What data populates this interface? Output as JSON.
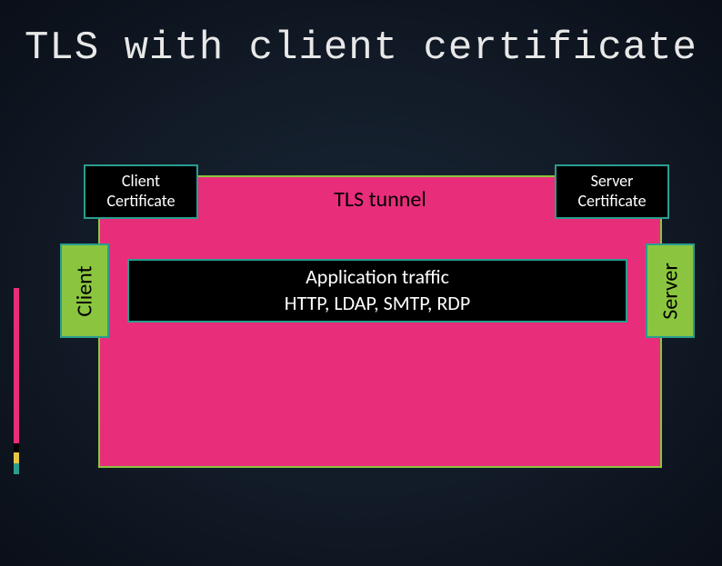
{
  "title": "TLS with client certificate",
  "diagram": {
    "tls_tunnel_label": "TLS tunnel",
    "client_cert_line1": "Client",
    "client_cert_line2": "Certificate",
    "server_cert_line1": "Server",
    "server_cert_line2": "Certificate",
    "client_label": "Client",
    "server_label": "Server",
    "app_traffic_line1": "Application traffic",
    "app_traffic_line2": "HTTP, LDAP, SMTP, RDP"
  },
  "colors": {
    "tunnel_bg": "#e82d7a",
    "accent_green": "#8bc53f",
    "border_teal": "#2a9d8f",
    "box_black": "#000000"
  }
}
